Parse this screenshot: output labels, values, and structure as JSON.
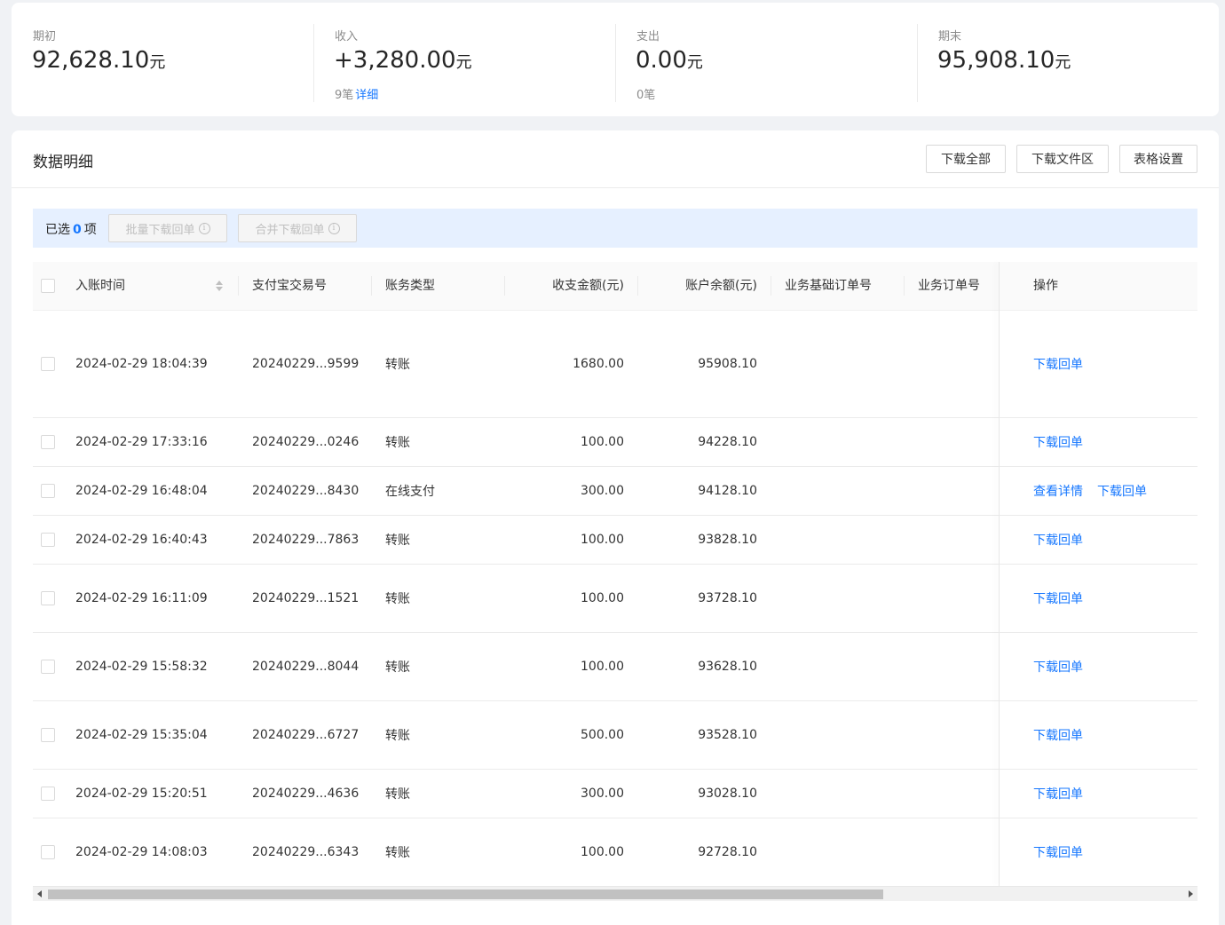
{
  "summary": {
    "opening": {
      "label": "期初",
      "value": "92,628.10",
      "unit": "元"
    },
    "income": {
      "label": "收入",
      "value": "+3,280.00",
      "unit": "元",
      "count": "9笔",
      "detail": "详细"
    },
    "expense": {
      "label": "支出",
      "value": "0.00",
      "unit": "元",
      "count": "0笔"
    },
    "closing": {
      "label": "期末",
      "value": "95,908.10",
      "unit": "元"
    }
  },
  "panel": {
    "title": "数据明细",
    "buttons": {
      "download_all": "下载全部",
      "download_files": "下载文件区",
      "table_settings": "表格设置"
    }
  },
  "selection": {
    "prefix": "已选",
    "count": "0",
    "suffix": "项",
    "batch_download": "批量下载回单",
    "merge_download": "合并下载回单",
    "info_icon": "i"
  },
  "columns": {
    "time": "入账时间",
    "trade_no": "支付宝交易号",
    "type": "账务类型",
    "amount": "收支金额(元)",
    "balance": "账户余额(元)",
    "base_order": "业务基础订单号",
    "order": "业务订单号",
    "action": "操作"
  },
  "rows": [
    {
      "time": "2024-02-29 18:04:39",
      "trade_no": "20240229...9599",
      "type": "转账",
      "amount": "1680.00",
      "balance": "95908.10",
      "actions": [
        "下载回单"
      ]
    },
    {
      "time": "2024-02-29 17:33:16",
      "trade_no": "20240229...0246",
      "type": "转账",
      "amount": "100.00",
      "balance": "94228.10",
      "actions": [
        "下载回单"
      ]
    },
    {
      "time": "2024-02-29 16:48:04",
      "trade_no": "20240229...8430",
      "type": "在线支付",
      "amount": "300.00",
      "balance": "94128.10",
      "actions": [
        "查看详情",
        "下载回单"
      ]
    },
    {
      "time": "2024-02-29 16:40:43",
      "trade_no": "20240229...7863",
      "type": "转账",
      "amount": "100.00",
      "balance": "93828.10",
      "actions": [
        "下载回单"
      ]
    },
    {
      "time": "2024-02-29 16:11:09",
      "trade_no": "20240229...1521",
      "type": "转账",
      "amount": "100.00",
      "balance": "93728.10",
      "actions": [
        "下载回单"
      ]
    },
    {
      "time": "2024-02-29 15:58:32",
      "trade_no": "20240229...8044",
      "type": "转账",
      "amount": "100.00",
      "balance": "93628.10",
      "actions": [
        "下载回单"
      ]
    },
    {
      "time": "2024-02-29 15:35:04",
      "trade_no": "20240229...6727",
      "type": "转账",
      "amount": "500.00",
      "balance": "93528.10",
      "actions": [
        "下载回单"
      ]
    },
    {
      "time": "2024-02-29 15:20:51",
      "trade_no": "20240229...4636",
      "type": "转账",
      "amount": "300.00",
      "balance": "93028.10",
      "actions": [
        "下载回单"
      ]
    },
    {
      "time": "2024-02-29 14:08:03",
      "trade_no": "20240229...6343",
      "type": "转账",
      "amount": "100.00",
      "balance": "92728.10",
      "actions": [
        "下载回单"
      ]
    }
  ],
  "colors": {
    "accent": "#1677ff",
    "select_bar": "#e6f0ff"
  }
}
